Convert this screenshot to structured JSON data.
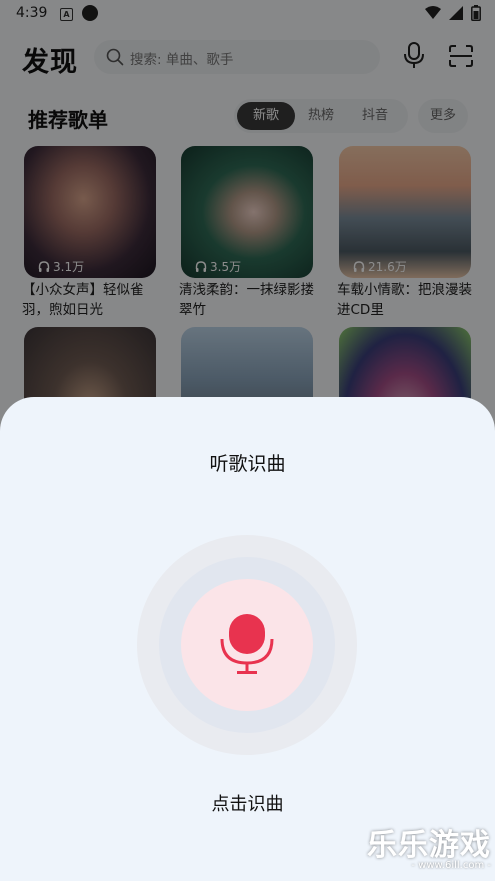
{
  "status_bar": {
    "time": "4:39",
    "app_icon_letter": "A"
  },
  "header": {
    "title": "发现",
    "search_placeholder": "搜索: 单曲、歌手",
    "mic_icon": "mic-icon",
    "scan_icon": "scan-icon"
  },
  "section": {
    "title": "推荐歌单",
    "tabs": [
      {
        "label": "新歌",
        "active": true
      },
      {
        "label": "热榜",
        "active": false
      },
      {
        "label": "抖音",
        "active": false
      }
    ],
    "more_label": "更多"
  },
  "playlists": [
    {
      "title": "【小众女声】轻似雀羽，煦如日光",
      "plays": "3.1万"
    },
    {
      "title": "清浅柔韵：一抹绿影搂翠竹",
      "plays": "3.5万"
    },
    {
      "title": "车载小情歌：把浪漫装进CD里",
      "plays": "21.6万"
    },
    {
      "title": "",
      "plays": ""
    },
    {
      "title": "",
      "plays": ""
    },
    {
      "title": "",
      "plays": ""
    }
  ],
  "sheet": {
    "title": "听歌识曲",
    "action": "点击识曲",
    "accent_color": "#e8334f"
  },
  "watermark": {
    "main": "乐乐游戏",
    "sub": "- www.6ill.com -"
  }
}
